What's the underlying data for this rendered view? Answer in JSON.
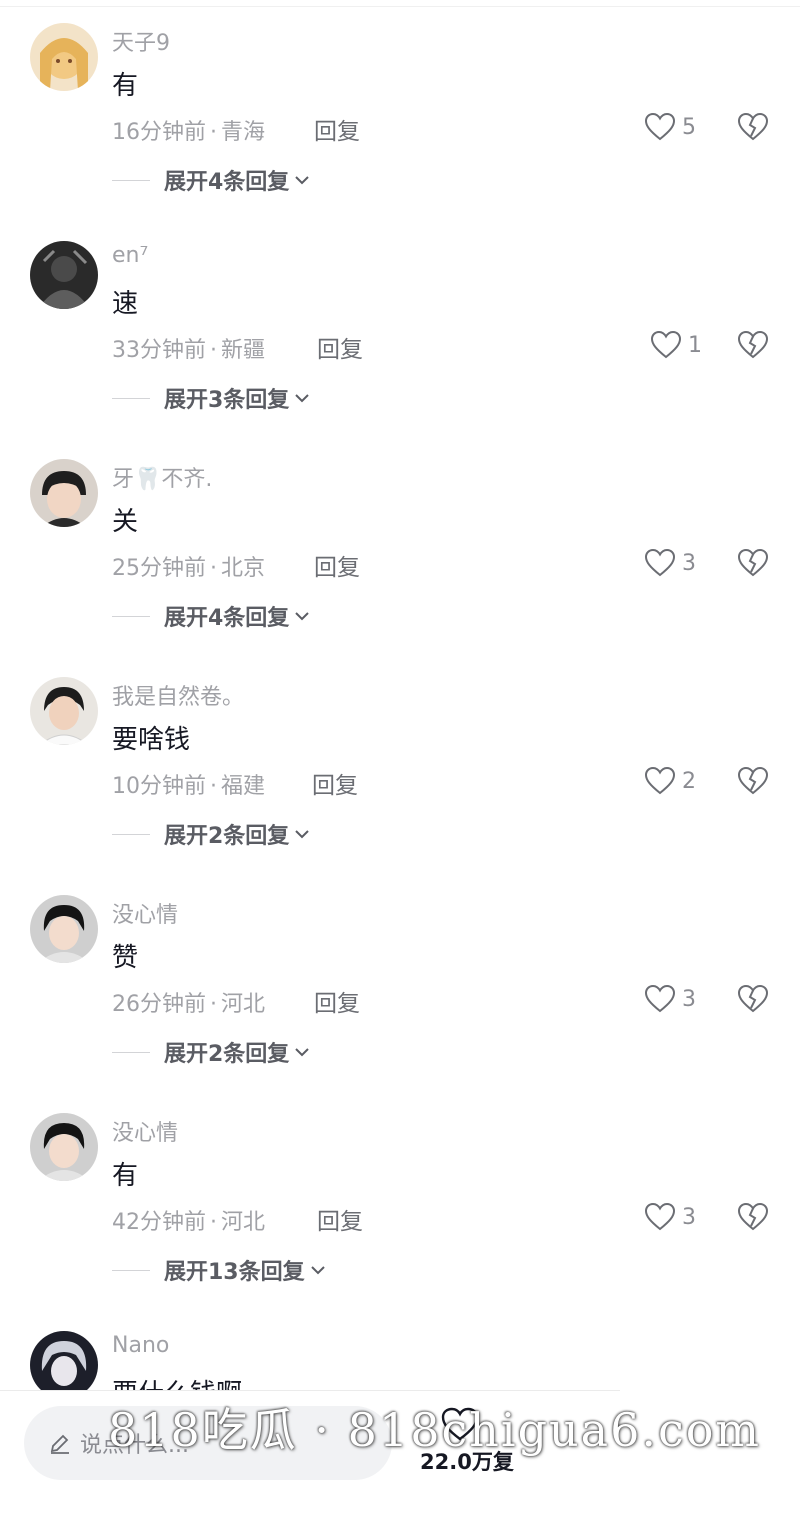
{
  "reply_label": "回复",
  "colors": {
    "text_primary": "#161823",
    "text_secondary": "#a0a1a6",
    "input_bg": "#f1f2f4"
  },
  "icons": {
    "like": "heart-outline-icon",
    "dislike": "broken-heart-icon",
    "expand": "chevron-down-icon",
    "compose": "pencil-icon"
  },
  "comments": [
    {
      "username": "天子9",
      "text": "有",
      "time": "16分钟前",
      "location": "青海",
      "likes": "5",
      "expand_label": "展开4条回复"
    },
    {
      "username": "en⁷",
      "text": "速",
      "time": "33分钟前",
      "location": "新疆",
      "likes": "1",
      "expand_label": "展开3条回复"
    },
    {
      "username": "牙🦷不齐.",
      "text": "关",
      "time": "25分钟前",
      "location": "北京",
      "likes": "3",
      "expand_label": "展开4条回复"
    },
    {
      "username": "我是自然卷。",
      "text": "要啥钱",
      "time": "10分钟前",
      "location": "福建",
      "likes": "2",
      "expand_label": "展开2条回复"
    },
    {
      "username": "没心情",
      "text": "赞",
      "time": "26分钟前",
      "location": "河北",
      "likes": "3",
      "expand_label": "展开2条回复"
    },
    {
      "username": "没心情",
      "text": "有",
      "time": "42分钟前",
      "location": "河北",
      "likes": "3",
      "expand_label": "展开13条回复"
    },
    {
      "username": "Nano",
      "text": "要什么钱啊"
    }
  ],
  "bottom_bar": {
    "input_placeholder": "说点什么...",
    "count_label": "22.0万复"
  },
  "watermark": "818吃瓜 · 818chigua6.com"
}
